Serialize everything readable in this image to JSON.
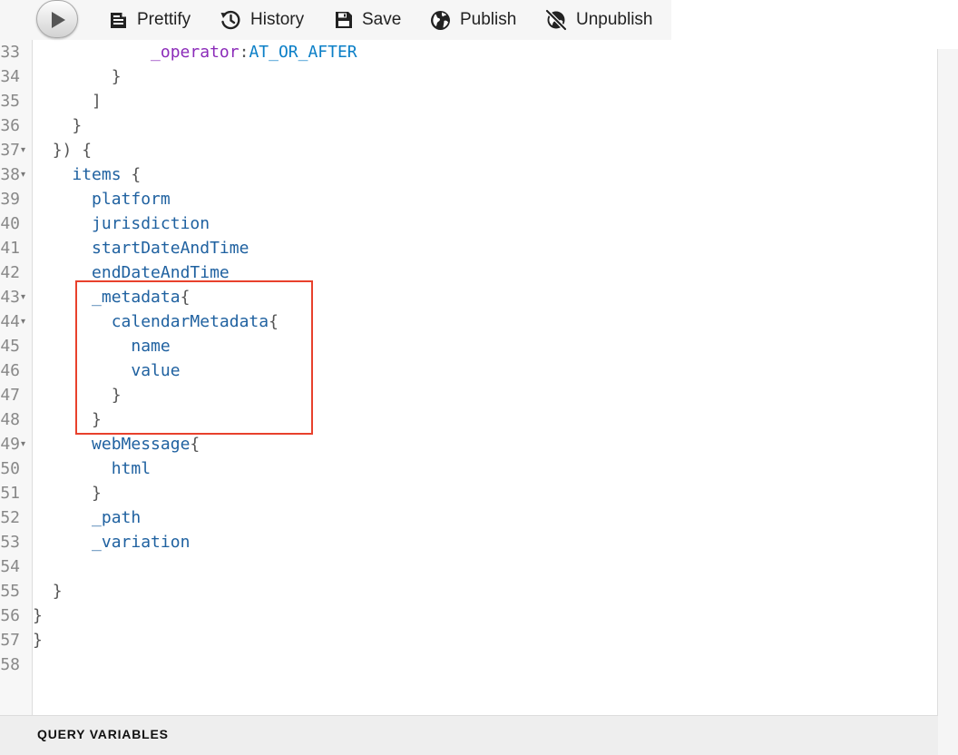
{
  "toolbar": {
    "execute_icon": "play-icon",
    "buttons": [
      {
        "label": "Prettify",
        "icon": "prettify-icon"
      },
      {
        "label": "History",
        "icon": "history-icon"
      },
      {
        "label": "Save",
        "icon": "save-icon"
      },
      {
        "label": "Publish",
        "icon": "globe-icon"
      },
      {
        "label": "Unpublish",
        "icon": "unpublish-icon"
      }
    ]
  },
  "editor": {
    "lines": [
      {
        "number": "33",
        "fold": false,
        "indent": 6,
        "tokens": [
          {
            "t": "_operator",
            "k": "arg"
          },
          {
            "t": ":",
            "k": "punct"
          },
          {
            "t": "AT_OR_AFTER",
            "k": "enum"
          }
        ]
      },
      {
        "number": "34",
        "fold": false,
        "indent": 4,
        "tokens": [
          {
            "t": "}",
            "k": "punct"
          }
        ]
      },
      {
        "number": "35",
        "fold": false,
        "indent": 3,
        "tokens": [
          {
            "t": "]",
            "k": "punct"
          }
        ]
      },
      {
        "number": "36",
        "fold": false,
        "indent": 2,
        "tokens": [
          {
            "t": "}",
            "k": "punct"
          }
        ]
      },
      {
        "number": "37",
        "fold": true,
        "indent": 1,
        "tokens": [
          {
            "t": "}) {",
            "k": "punct"
          }
        ]
      },
      {
        "number": "38",
        "fold": true,
        "indent": 2,
        "tokens": [
          {
            "t": "items",
            "k": "field"
          },
          {
            "t": " {",
            "k": "punct"
          }
        ]
      },
      {
        "number": "39",
        "fold": false,
        "indent": 3,
        "tokens": [
          {
            "t": "platform",
            "k": "field"
          }
        ]
      },
      {
        "number": "40",
        "fold": false,
        "indent": 3,
        "tokens": [
          {
            "t": "jurisdiction",
            "k": "field"
          }
        ]
      },
      {
        "number": "41",
        "fold": false,
        "indent": 3,
        "tokens": [
          {
            "t": "startDateAndTime",
            "k": "field"
          }
        ]
      },
      {
        "number": "42",
        "fold": false,
        "indent": 3,
        "tokens": [
          {
            "t": "endDateAndTime",
            "k": "field"
          }
        ]
      },
      {
        "number": "43",
        "fold": true,
        "indent": 3,
        "tokens": [
          {
            "t": "_metadata",
            "k": "field"
          },
          {
            "t": "{",
            "k": "punct"
          }
        ]
      },
      {
        "number": "44",
        "fold": true,
        "indent": 4,
        "tokens": [
          {
            "t": "calendarMetadata",
            "k": "field"
          },
          {
            "t": "{",
            "k": "punct"
          }
        ]
      },
      {
        "number": "45",
        "fold": false,
        "indent": 5,
        "tokens": [
          {
            "t": "name",
            "k": "field"
          }
        ]
      },
      {
        "number": "46",
        "fold": false,
        "indent": 5,
        "tokens": [
          {
            "t": "value",
            "k": "field"
          }
        ]
      },
      {
        "number": "47",
        "fold": false,
        "indent": 4,
        "tokens": [
          {
            "t": "}",
            "k": "punct"
          }
        ]
      },
      {
        "number": "48",
        "fold": false,
        "indent": 3,
        "tokens": [
          {
            "t": "}",
            "k": "punct"
          }
        ]
      },
      {
        "number": "49",
        "fold": true,
        "indent": 3,
        "tokens": [
          {
            "t": "webMessage",
            "k": "field"
          },
          {
            "t": "{",
            "k": "punct"
          }
        ]
      },
      {
        "number": "50",
        "fold": false,
        "indent": 4,
        "tokens": [
          {
            "t": "html",
            "k": "field"
          }
        ]
      },
      {
        "number": "51",
        "fold": false,
        "indent": 3,
        "tokens": [
          {
            "t": "}",
            "k": "punct"
          }
        ]
      },
      {
        "number": "52",
        "fold": false,
        "indent": 3,
        "tokens": [
          {
            "t": "_path",
            "k": "field"
          }
        ]
      },
      {
        "number": "53",
        "fold": false,
        "indent": 3,
        "tokens": [
          {
            "t": "_variation",
            "k": "field"
          }
        ]
      },
      {
        "number": "54",
        "fold": false,
        "indent": 0,
        "tokens": []
      },
      {
        "number": "55",
        "fold": false,
        "indent": 1,
        "tokens": [
          {
            "t": "}",
            "k": "punct"
          }
        ]
      },
      {
        "number": "56",
        "fold": false,
        "indent": 0,
        "tokens": [
          {
            "t": "}",
            "k": "punct"
          }
        ]
      },
      {
        "number": "57",
        "fold": false,
        "indent": 0,
        "tokens": [
          {
            "t": "}",
            "k": "punct"
          }
        ]
      },
      {
        "number": "58",
        "fold": false,
        "indent": 0,
        "tokens": []
      }
    ],
    "highlight_color": "#e8412c"
  },
  "query_variables": {
    "title": "QUERY VARIABLES"
  }
}
